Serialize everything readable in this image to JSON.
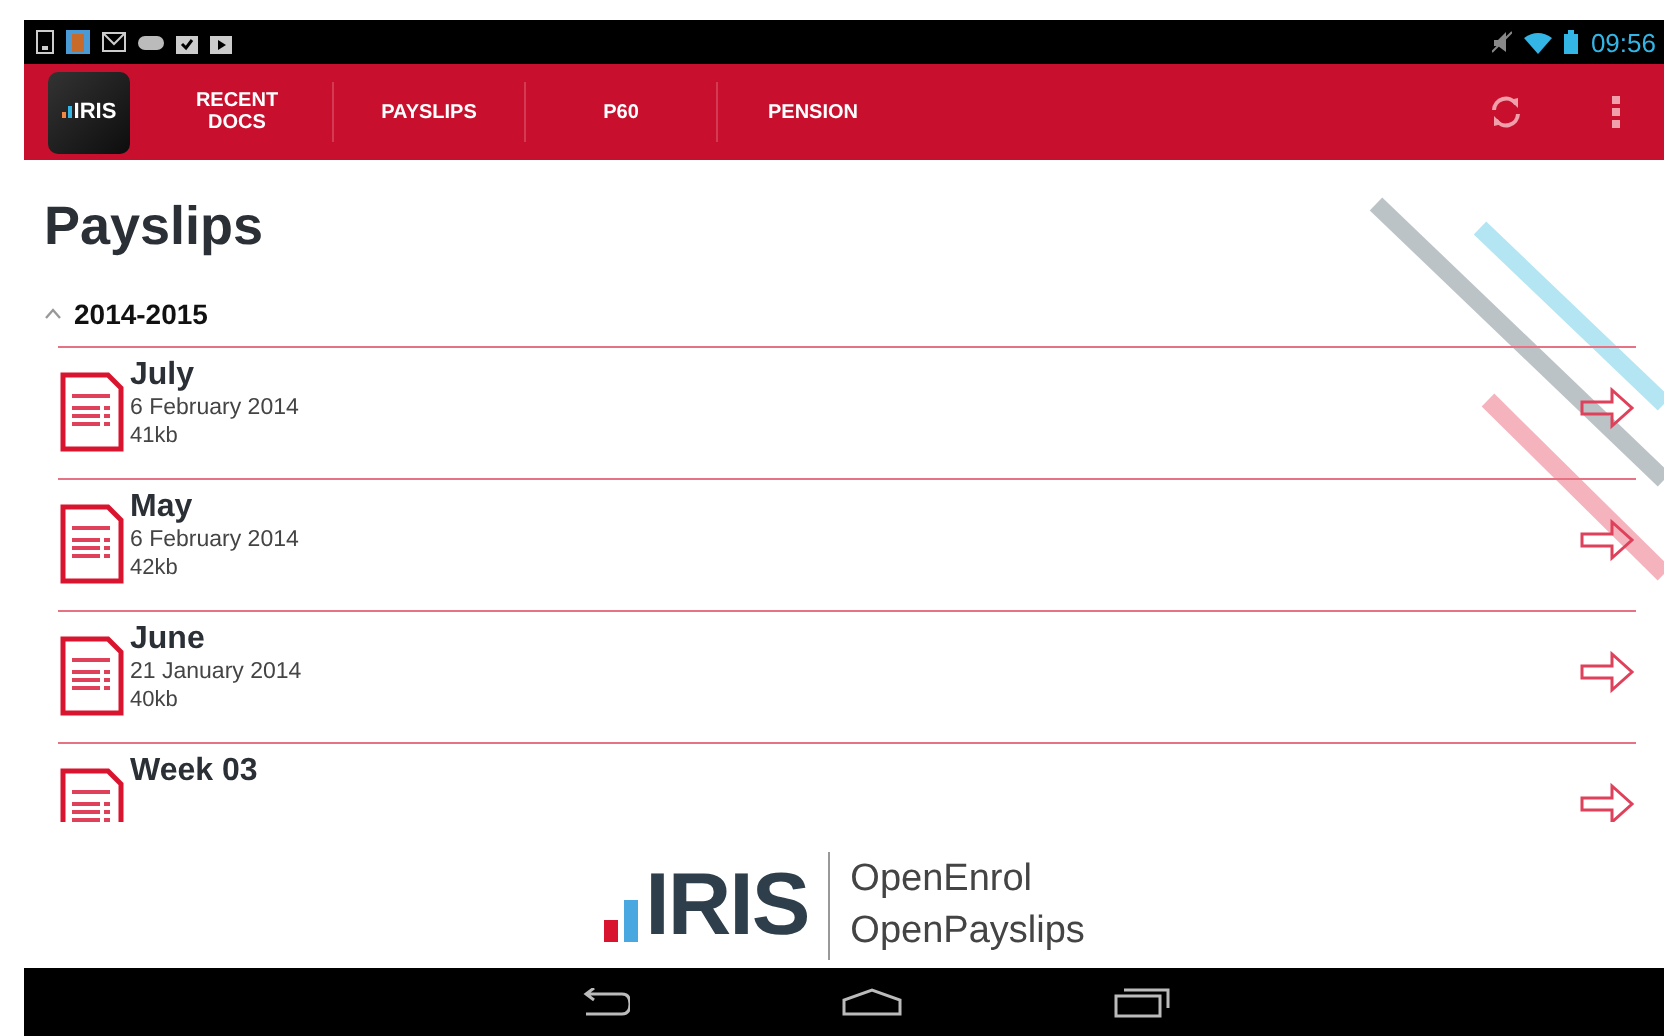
{
  "status_bar": {
    "time": "09:56"
  },
  "app_bar": {
    "logo": "IRIS",
    "tabs": [
      {
        "label": "RECENT DOCS"
      },
      {
        "label": "PAYSLIPS"
      },
      {
        "label": "P60"
      },
      {
        "label": "PENSION"
      }
    ]
  },
  "page": {
    "title": "Payslips"
  },
  "section": {
    "label": "2014-2015",
    "expanded": true,
    "items": [
      {
        "title": "July",
        "date": "6 February 2014",
        "size": "41kb"
      },
      {
        "title": "May",
        "date": "6 February 2014",
        "size": "42kb"
      },
      {
        "title": "June",
        "date": "21 January 2014",
        "size": "40kb"
      },
      {
        "title": "Week 03"
      }
    ]
  },
  "footer": {
    "brand": "IRIS",
    "products": [
      "OpenEnrol",
      "OpenPayslips"
    ]
  }
}
